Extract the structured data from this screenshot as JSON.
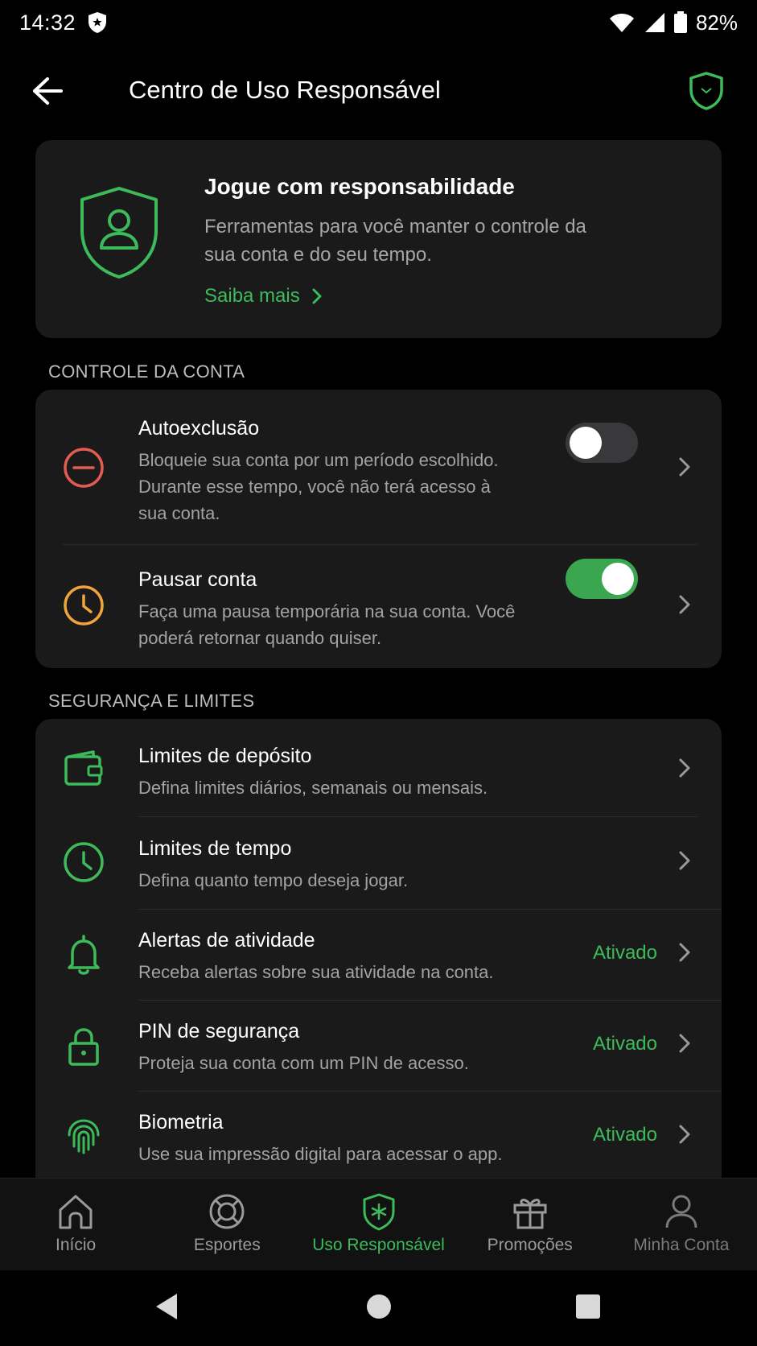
{
  "status_bar": {
    "time": "14:32",
    "battery": "82%"
  },
  "header": {
    "title": "Centro de Uso Responsável"
  },
  "hero": {
    "title": "Jogue com responsabilidade",
    "description": "Ferramentas para você manter o controle da sua conta e do seu tempo.",
    "link": "Saiba mais"
  },
  "sections": {
    "account_control": {
      "label": "CONTROLE DA CONTA",
      "items": [
        {
          "title": "Autoexclusão",
          "description": "Bloqueie sua conta por um período escolhido. Durante esse tempo, você não terá acesso à sua conta.",
          "toggle": "off"
        },
        {
          "title": "Pausar conta",
          "description": "Faça uma pausa temporária na sua conta. Você poderá retornar quando quiser.",
          "toggle": "on"
        }
      ]
    },
    "security_limits": {
      "label": "SEGURANÇA E LIMITES",
      "items": [
        {
          "title": "Limites de depósito",
          "description": "Defina limites diários, semanais ou mensais.",
          "status": ""
        },
        {
          "title": "Limites de tempo",
          "description": "Defina quanto tempo deseja jogar.",
          "status": ""
        },
        {
          "title": "Alertas de atividade",
          "description": "Receba alertas sobre sua atividade na conta.",
          "status": "Ativado"
        },
        {
          "title": "PIN de segurança",
          "description": "Proteja sua conta com um PIN de acesso.",
          "status": "Ativado"
        },
        {
          "title": "Biometria",
          "description": "Use sua impressão digital para acessar o app.",
          "status": "Ativado"
        }
      ]
    }
  },
  "bottom_nav": [
    {
      "label": "Início",
      "icon": "home-icon",
      "active": false
    },
    {
      "label": "Esportes",
      "icon": "ball-icon",
      "active": false
    },
    {
      "label": "Uso Responsável",
      "icon": "shield-star-icon",
      "active": true
    },
    {
      "label": "Promoções",
      "icon": "gift-icon",
      "active": false
    },
    {
      "label": "Minha Conta",
      "icon": "user-icon",
      "active": false
    }
  ],
  "colors": {
    "accent": "#3dba5a",
    "red": "#e55b52",
    "orange": "#f2a43a",
    "card": "#1a1a1b"
  }
}
